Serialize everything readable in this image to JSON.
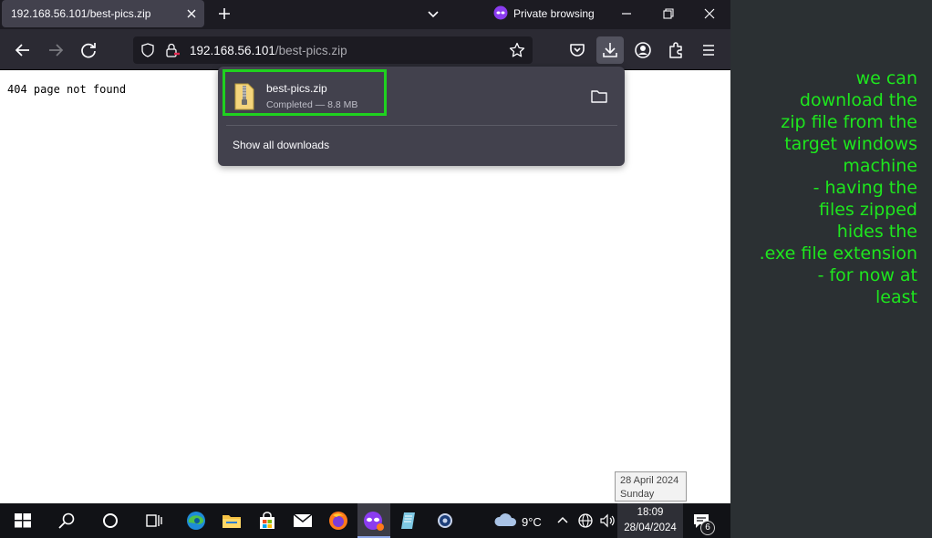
{
  "browser": {
    "tab": {
      "title": "192.168.56.101/best-pics.zip"
    },
    "private_label": "Private browsing",
    "url": {
      "host": "192.168.56.101",
      "path": "/best-pics.zip"
    }
  },
  "page": {
    "body_text": "404 page not found"
  },
  "downloads_panel": {
    "item": {
      "filename": "best-pics.zip",
      "status": "Completed — 8.8 MB"
    },
    "show_all_label": "Show all downloads"
  },
  "tooltip": {
    "date": "28 April 2024",
    "day": "Sunday"
  },
  "taskbar": {
    "weather_temp": "9°C",
    "clock_time": "18:09",
    "clock_date": "28/04/2024",
    "notification_count": "6"
  },
  "annotation": "we can\ndownload the\nzip file from the\ntarget windows\nmachine\n- having the\nfiles zipped\nhides the\n.exe file extension\n- for now at\nleast",
  "colors": {
    "annotation": "#1ee61e",
    "highlight_box": "#1fd21f",
    "private_purple": "#8b3cf0"
  },
  "icons": [
    "close-icon",
    "plus-icon",
    "chevron-down-icon",
    "private-mask-icon",
    "minimize-icon",
    "maximize-icon",
    "back-icon",
    "forward-icon",
    "reload-icon",
    "shield-icon",
    "lock-warning-icon",
    "star-icon",
    "pocket-icon",
    "download-icon",
    "account-icon",
    "extensions-icon",
    "menu-icon",
    "zip-file-icon",
    "folder-icon",
    "windows-start-icon",
    "search-icon",
    "cortana-icon",
    "task-view-icon",
    "edge-icon",
    "file-explorer-icon",
    "store-icon",
    "mail-icon",
    "firefox-icon",
    "firefox-private-icon",
    "notepad-icon",
    "settings-icon",
    "weather-cloud-icon",
    "chevron-up-icon",
    "globe-icon",
    "volume-icon",
    "notification-icon"
  ]
}
